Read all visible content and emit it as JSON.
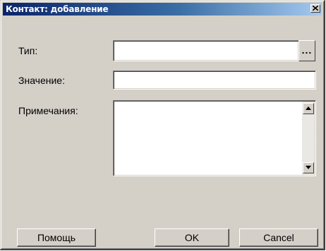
{
  "window": {
    "title": "Контакт: добавление"
  },
  "form": {
    "type_label": "Тип:",
    "type_value": "",
    "browse_label": "...",
    "value_label": "Значение:",
    "value_value": "",
    "notes_label": "Примечания:",
    "notes_value": ""
  },
  "buttons": {
    "help": "Помощь",
    "ok": "OK",
    "cancel": "Cancel"
  },
  "icons": {
    "close": "close-icon",
    "scroll_up": "arrow-up-icon",
    "scroll_down": "arrow-down-icon"
  }
}
